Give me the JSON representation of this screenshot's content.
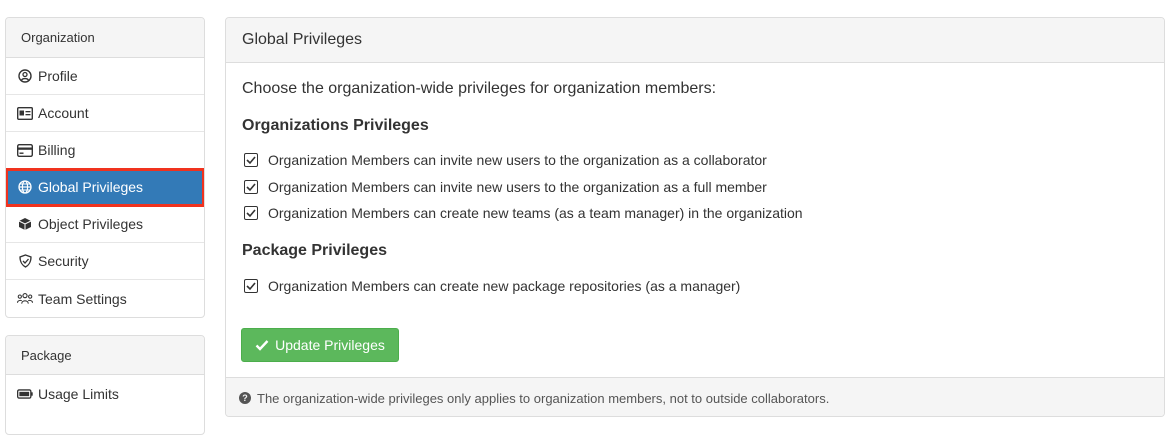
{
  "sidebar": {
    "org_header": "Organization",
    "items": [
      {
        "label": "Profile",
        "icon": "user-circle-icon"
      },
      {
        "label": "Account",
        "icon": "id-card-icon"
      },
      {
        "label": "Billing",
        "icon": "credit-card-icon"
      },
      {
        "label": "Global Privileges",
        "icon": "globe-icon"
      },
      {
        "label": "Object Privileges",
        "icon": "cube-icon"
      },
      {
        "label": "Security",
        "icon": "shield-icon"
      },
      {
        "label": "Team Settings",
        "icon": "users-icon"
      }
    ],
    "pkg_header": "Package",
    "pkg_items": [
      {
        "label": "Usage Limits",
        "icon": "battery-icon"
      }
    ]
  },
  "main": {
    "title": "Global Privileges",
    "intro": "Choose the organization-wide privileges for organization members:",
    "org_section_title": "Organizations Privileges",
    "org_privileges": [
      {
        "label": "Organization Members can invite new users to the organization as a collaborator",
        "checked": true
      },
      {
        "label": "Organization Members can invite new users to the organization as a full member",
        "checked": true
      },
      {
        "label": "Organization Members can create new teams (as a team manager) in the organization",
        "checked": true
      }
    ],
    "pkg_section_title": "Package Privileges",
    "pkg_privileges": [
      {
        "label": "Organization Members can create new package repositories (as a manager)",
        "checked": true
      }
    ],
    "update_button": "Update Privileges",
    "footer_note": "The organization-wide privileges only applies to organization members, not to outside collaborators.",
    "colors": {
      "primary": "#337ab7",
      "success": "#5cb85c",
      "highlight": "#f0321e"
    }
  }
}
